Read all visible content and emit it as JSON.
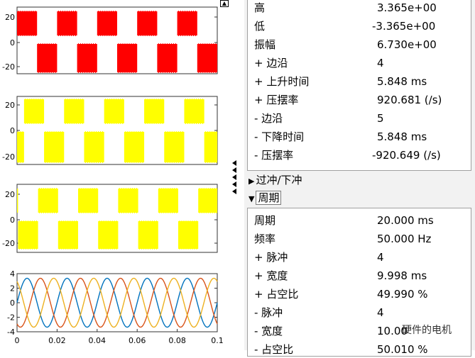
{
  "colors": {
    "red": "#ff0000",
    "yellow": "#ffff00",
    "blue": "#0072bd",
    "orange": "#d95319",
    "gold": "#edb120"
  },
  "icons": {
    "expand": "expand-window-icon",
    "collapse": "splitter-arrow-icon"
  },
  "plots": [
    {
      "id": "p1",
      "yticks": [
        "20",
        "0",
        "-20"
      ],
      "color": "#ff0000",
      "signal": "pwm-red"
    },
    {
      "id": "p2",
      "yticks": [
        "20",
        "0",
        "-20"
      ],
      "color": "#ffff00",
      "signal": "pwm-yellow"
    },
    {
      "id": "p3",
      "yticks": [
        "20",
        "0",
        "-20"
      ],
      "color": "#ffff00",
      "signal": "pwm-yellow-shifted"
    },
    {
      "id": "p4",
      "yticks": [
        "4",
        "2",
        "0",
        "-2",
        "-4"
      ],
      "xticks": [
        "0",
        "0.02",
        "0.04",
        "0.06",
        "0.08",
        "0.1"
      ],
      "signal": "three-phase-sine"
    }
  ],
  "chart_data": {
    "type": "line",
    "xlim": [
      0,
      0.1
    ],
    "ylim": [
      -4,
      4
    ],
    "frequency_hz": 50,
    "amplitude": 3.365,
    "yticks": [
      4,
      2,
      0,
      -2,
      -4
    ],
    "xticks": [
      0,
      0.02,
      0.04,
      0.06,
      0.08,
      0.1
    ],
    "series": [
      {
        "color": "#0072bd",
        "phase_deg": 0
      },
      {
        "color": "#d95319",
        "phase_deg": -120
      },
      {
        "color": "#edb120",
        "phase_deg": 120
      }
    ]
  },
  "measurements": {
    "edges": [
      {
        "label": "高",
        "value": "3.365e+00"
      },
      {
        "label": "低",
        "value": "-3.365e+00"
      },
      {
        "label": "振幅",
        "value": "6.730e+00"
      },
      {
        "label": "+ 边沿",
        "value": "4"
      },
      {
        "label": "+ 上升时间",
        "value": "5.848 ms"
      },
      {
        "label": "+ 压摆率",
        "value": "920.681 (/s)"
      },
      {
        "label": "- 边沿",
        "value": "5"
      },
      {
        "label": "- 下降时间",
        "value": "5.848 ms"
      },
      {
        "label": "- 压摆率",
        "value": "-920.649 (/s)"
      }
    ],
    "overshoot_header": "过冲/下冲",
    "period_header": "周期",
    "period": [
      {
        "label": "周期",
        "value": "20.000 ms"
      },
      {
        "label": "频率",
        "value": "50.000 Hz"
      },
      {
        "label": "+ 脉冲",
        "value": "4"
      },
      {
        "label": "+ 宽度",
        "value": "9.998 ms"
      },
      {
        "label": "+ 占空比",
        "value": "49.990 %"
      },
      {
        "label": "- 脉冲",
        "value": "4"
      },
      {
        "label": "- 宽度",
        "value": "10.00"
      },
      {
        "label": "- 占空比",
        "value": "50.010 %"
      }
    ]
  },
  "watermark": "硬件的电机"
}
